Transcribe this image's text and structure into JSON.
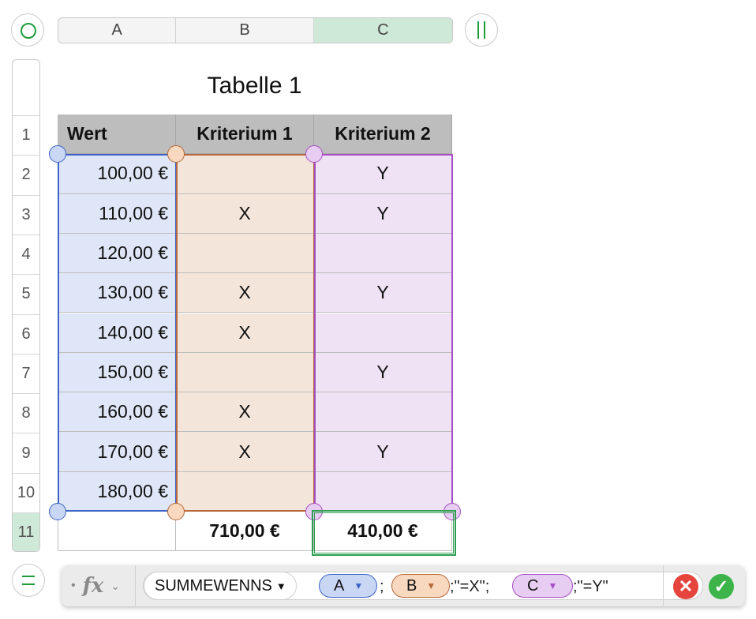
{
  "column_headers": [
    "A",
    "B",
    "C"
  ],
  "selected_column": "C",
  "row_numbers": [
    "1",
    "2",
    "3",
    "4",
    "5",
    "6",
    "7",
    "8",
    "9",
    "10",
    "11"
  ],
  "selected_row": "11",
  "table": {
    "title": "Tabelle 1",
    "headers": [
      "Wert",
      "Kriterium 1",
      "Kriterium 2"
    ],
    "rows": [
      [
        "100,00 €",
        "",
        "Y"
      ],
      [
        "110,00 €",
        "X",
        "Y"
      ],
      [
        "120,00 €",
        "",
        ""
      ],
      [
        "130,00 €",
        "X",
        "Y"
      ],
      [
        "140,00 €",
        "X",
        ""
      ],
      [
        "150,00 €",
        "",
        "Y"
      ],
      [
        "160,00 €",
        "X",
        ""
      ],
      [
        "170,00 €",
        "X",
        "Y"
      ],
      [
        "180,00 €",
        "",
        ""
      ]
    ],
    "footer": [
      "",
      "710,00 €",
      "410,00 €"
    ]
  },
  "range_colors": {
    "A": {
      "fill": "#dfe6f7",
      "border": "#3d63c7",
      "handle": "#c9d6f4"
    },
    "B": {
      "fill": "#f3e5da",
      "border": "#b6683a",
      "handle": "#f8d9bf"
    },
    "C": {
      "fill": "#f0e2f5",
      "border": "#a64fc4",
      "handle": "#e7cdf1"
    }
  },
  "formula_bar": {
    "dot": "•",
    "fx_icon": "fx-icon",
    "function_name": "SUMMEWENNS",
    "tokens": [
      {
        "label": "A",
        "color": "A"
      },
      {
        "sep": ";"
      },
      {
        "label": "B",
        "color": "B"
      },
      {
        "sep": ";\"=X\";"
      },
      {
        "label": "C",
        "color": "C"
      },
      {
        "sep": ";\"=Y\""
      }
    ],
    "cancel_icon": "cancel-icon",
    "confirm_icon": "confirm-icon"
  },
  "accent_color": "#1f9d3c"
}
